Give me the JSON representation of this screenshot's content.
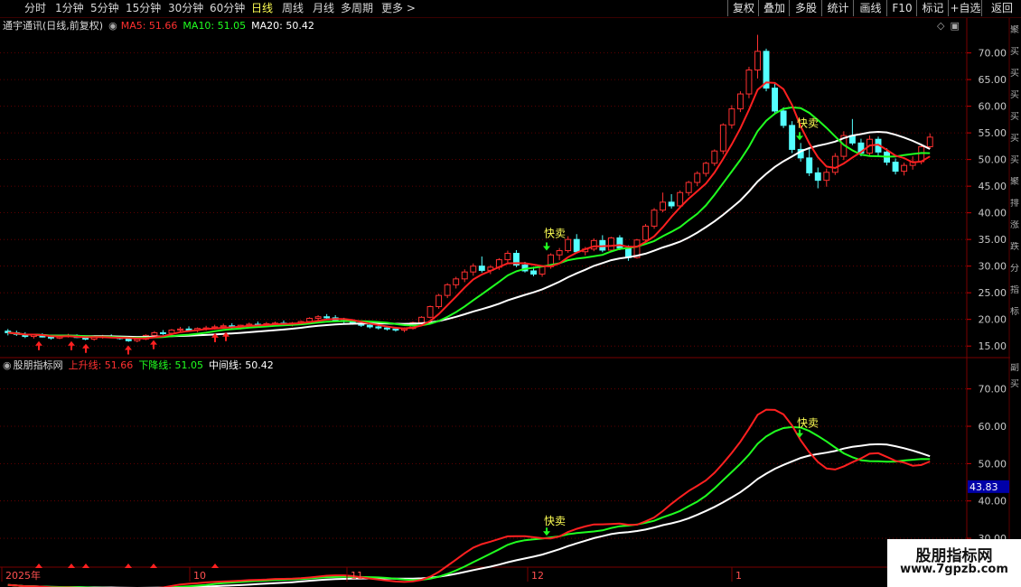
{
  "toolbar": {
    "timeframes": [
      "分时",
      "1分钟",
      "5分钟",
      "15分钟",
      "30分钟",
      "60分钟",
      "日线",
      "周线",
      "月线",
      "多周期"
    ],
    "more_label": "更多",
    "active_timeframe": "日线",
    "right_buttons": [
      "复权",
      "叠加",
      "多股",
      "统计",
      "画线",
      "F10",
      "标记",
      "+自选",
      "返回"
    ]
  },
  "main_panel": {
    "stock_name": "通宇通讯(日线,前复权)",
    "ma5_label": "MA5: 51.66",
    "ma10_label": "MA10: 51.05",
    "ma20_label": "MA20: 50.42",
    "price_ticks": [
      "70.00",
      "65.00",
      "60.00",
      "55.00",
      "50.00",
      "45.00",
      "40.00",
      "35.00",
      "30.00",
      "25.00",
      "20.00",
      "15.00"
    ],
    "sell_labels": [
      "快卖",
      "快卖"
    ]
  },
  "indicator_panel": {
    "name": "股朋指标网",
    "up_label": "上升线: 51.66",
    "down_label": "下降线: 51.05",
    "mid_label": "中间线: 50.42",
    "ticks": [
      "70.00",
      "60.00",
      "50.00",
      "40.00",
      "30.00"
    ],
    "cursor_value": "43.83",
    "sell_labels": [
      "快卖",
      "快卖"
    ]
  },
  "time_axis": {
    "labels": [
      "2025年",
      "10",
      "11",
      "12",
      "1"
    ]
  },
  "side_strip": {
    "top_chars": [
      "聚",
      "买",
      "买",
      "买",
      "买",
      "买",
      "买",
      "聚",
      "排",
      "涨",
      "跌",
      "分",
      "指",
      "标"
    ],
    "bottom_chars": [
      "副",
      "买"
    ]
  },
  "watermark": {
    "name": "股朋指标网",
    "url": "www.7gpzb.com"
  },
  "colors": {
    "up": "#ff3030",
    "down": "#54ffff",
    "ma5": "#ff2020",
    "ma10": "#20ff20",
    "ma20": "#ffffff",
    "active": "#ffff54",
    "grid": "#7a0000",
    "cursor_box": "#0000a8"
  },
  "chart_data": {
    "type": "candlestick",
    "price_range": [
      13,
      74
    ],
    "candles": [
      [
        17.8,
        18.2,
        17.0,
        17.5
      ],
      [
        17.5,
        17.9,
        16.9,
        17.2
      ],
      [
        17.2,
        17.6,
        16.5,
        16.8
      ],
      [
        16.8,
        17.3,
        16.4,
        17.1
      ],
      [
        17.1,
        17.4,
        16.6,
        16.7
      ],
      [
        16.7,
        17.0,
        16.2,
        16.5
      ],
      [
        16.5,
        17.0,
        16.3,
        16.9
      ],
      [
        16.9,
        17.3,
        16.6,
        17.0
      ],
      [
        17.0,
        17.2,
        16.5,
        16.6
      ],
      [
        16.6,
        16.9,
        16.1,
        16.3
      ],
      [
        16.3,
        16.8,
        16.0,
        16.7
      ],
      [
        16.7,
        17.1,
        16.4,
        16.8
      ],
      [
        16.8,
        17.2,
        16.5,
        16.6
      ],
      [
        16.6,
        16.9,
        16.2,
        16.4
      ],
      [
        16.4,
        16.7,
        15.8,
        16.0
      ],
      [
        16.0,
        16.5,
        15.7,
        16.3
      ],
      [
        16.3,
        17.2,
        16.1,
        17.0
      ],
      [
        17.0,
        17.8,
        16.8,
        17.5
      ],
      [
        17.5,
        18.0,
        17.1,
        17.4
      ],
      [
        17.4,
        18.2,
        17.2,
        18.0
      ],
      [
        18.0,
        18.6,
        17.6,
        18.2
      ],
      [
        18.2,
        18.7,
        17.8,
        18.0
      ],
      [
        18.0,
        18.5,
        17.6,
        18.3
      ],
      [
        18.3,
        18.8,
        17.9,
        18.4
      ],
      [
        18.4,
        19.0,
        18.1,
        18.6
      ],
      [
        18.6,
        19.2,
        18.3,
        18.8
      ],
      [
        18.8,
        19.3,
        18.3,
        18.5
      ],
      [
        18.5,
        19.0,
        18.1,
        18.9
      ],
      [
        18.9,
        19.4,
        18.5,
        19.1
      ],
      [
        19.1,
        19.6,
        18.7,
        19.0
      ],
      [
        19.0,
        19.5,
        18.6,
        19.2
      ],
      [
        19.2,
        19.6,
        18.8,
        19.3
      ],
      [
        19.3,
        19.8,
        18.9,
        19.1
      ],
      [
        19.1,
        19.5,
        18.7,
        19.3
      ],
      [
        19.3,
        19.8,
        19.0,
        19.6
      ],
      [
        19.6,
        20.4,
        19.3,
        20.2
      ],
      [
        20.2,
        20.8,
        19.8,
        20.5
      ],
      [
        20.5,
        21.0,
        20.0,
        20.3
      ],
      [
        20.3,
        20.8,
        19.6,
        19.8
      ],
      [
        19.8,
        20.3,
        19.3,
        19.6
      ],
      [
        19.6,
        20.0,
        19.0,
        19.2
      ],
      [
        19.2,
        19.6,
        18.6,
        18.9
      ],
      [
        18.9,
        19.3,
        18.3,
        18.6
      ],
      [
        18.6,
        19.0,
        18.1,
        18.4
      ],
      [
        18.4,
        18.8,
        17.9,
        18.2
      ],
      [
        18.2,
        18.6,
        17.7,
        18.0
      ],
      [
        18.0,
        18.5,
        17.6,
        18.3
      ],
      [
        18.3,
        19.6,
        18.1,
        19.4
      ],
      [
        19.4,
        20.6,
        19.2,
        20.4
      ],
      [
        20.4,
        22.6,
        20.2,
        22.4
      ],
      [
        22.4,
        24.8,
        22.0,
        24.5
      ],
      [
        24.5,
        26.8,
        24.0,
        26.5
      ],
      [
        26.5,
        28.0,
        25.8,
        27.6
      ],
      [
        27.6,
        29.4,
        27.0,
        28.9
      ],
      [
        28.9,
        30.5,
        28.2,
        30.0
      ],
      [
        30.0,
        31.8,
        28.8,
        29.2
      ],
      [
        29.2,
        30.2,
        28.5,
        29.8
      ],
      [
        29.8,
        31.5,
        29.3,
        31.2
      ],
      [
        31.2,
        32.9,
        30.5,
        32.4
      ],
      [
        32.4,
        33.0,
        29.8,
        30.2
      ],
      [
        30.2,
        30.8,
        28.8,
        29.1
      ],
      [
        29.1,
        29.9,
        28.1,
        28.5
      ],
      [
        28.5,
        30.2,
        28.0,
        29.9
      ],
      [
        29.9,
        32.4,
        29.5,
        32.1
      ],
      [
        32.1,
        33.4,
        31.1,
        32.9
      ],
      [
        32.9,
        35.6,
        32.5,
        35.0
      ],
      [
        35.0,
        36.0,
        32.4,
        32.7
      ],
      [
        32.7,
        33.6,
        32.0,
        33.2
      ],
      [
        33.2,
        35.2,
        32.8,
        34.8
      ],
      [
        34.8,
        35.8,
        32.6,
        33.0
      ],
      [
        33.0,
        35.5,
        32.7,
        35.3
      ],
      [
        35.3,
        35.8,
        33.0,
        33.4
      ],
      [
        33.4,
        33.9,
        31.0,
        31.6
      ],
      [
        31.6,
        35.1,
        31.4,
        34.9
      ],
      [
        34.9,
        37.9,
        34.5,
        37.5
      ],
      [
        37.5,
        40.9,
        37.0,
        40.5
      ],
      [
        40.5,
        43.8,
        40.1,
        42.0
      ],
      [
        42.0,
        43.5,
        40.8,
        41.3
      ],
      [
        41.3,
        44.2,
        41.0,
        43.8
      ],
      [
        43.8,
        46.0,
        43.2,
        45.7
      ],
      [
        45.7,
        47.8,
        45.0,
        47.4
      ],
      [
        47.4,
        49.6,
        46.8,
        49.3
      ],
      [
        49.3,
        51.9,
        48.8,
        51.6
      ],
      [
        51.6,
        56.8,
        51.0,
        56.5
      ],
      [
        56.5,
        60.2,
        55.8,
        59.5
      ],
      [
        59.5,
        62.8,
        58.9,
        62.3
      ],
      [
        62.3,
        67.4,
        61.5,
        66.8
      ],
      [
        66.8,
        73.4,
        65.2,
        70.3
      ],
      [
        70.3,
        70.8,
        62.8,
        63.4
      ],
      [
        63.4,
        64.2,
        58.6,
        59.1
      ],
      [
        59.1,
        59.8,
        55.9,
        56.4
      ],
      [
        56.4,
        57.2,
        51.2,
        51.9
      ],
      [
        51.9,
        53.1,
        49.6,
        50.3
      ],
      [
        50.3,
        52.2,
        46.9,
        47.5
      ],
      [
        47.5,
        48.5,
        44.6,
        46.1
      ],
      [
        46.1,
        48.3,
        44.9,
        47.6
      ],
      [
        47.6,
        51.2,
        47.1,
        50.6
      ],
      [
        50.6,
        55.3,
        49.9,
        54.5
      ],
      [
        54.5,
        57.6,
        52.7,
        53.1
      ],
      [
        53.1,
        53.9,
        50.6,
        51.2
      ],
      [
        51.2,
        54.5,
        50.8,
        53.8
      ],
      [
        53.8,
        54.3,
        50.7,
        51.4
      ],
      [
        51.4,
        52.1,
        48.9,
        49.5
      ],
      [
        49.5,
        50.2,
        47.2,
        47.8
      ],
      [
        47.8,
        49.4,
        47.0,
        48.9
      ],
      [
        48.9,
        50.6,
        48.1,
        49.6
      ],
      [
        49.6,
        52.8,
        49.1,
        52.4
      ],
      [
        52.4,
        54.9,
        52.0,
        54.2
      ]
    ],
    "series": [
      {
        "name": "MA5",
        "last": 51.66
      },
      {
        "name": "MA10",
        "last": 51.05
      },
      {
        "name": "MA20",
        "last": 50.42
      }
    ]
  }
}
